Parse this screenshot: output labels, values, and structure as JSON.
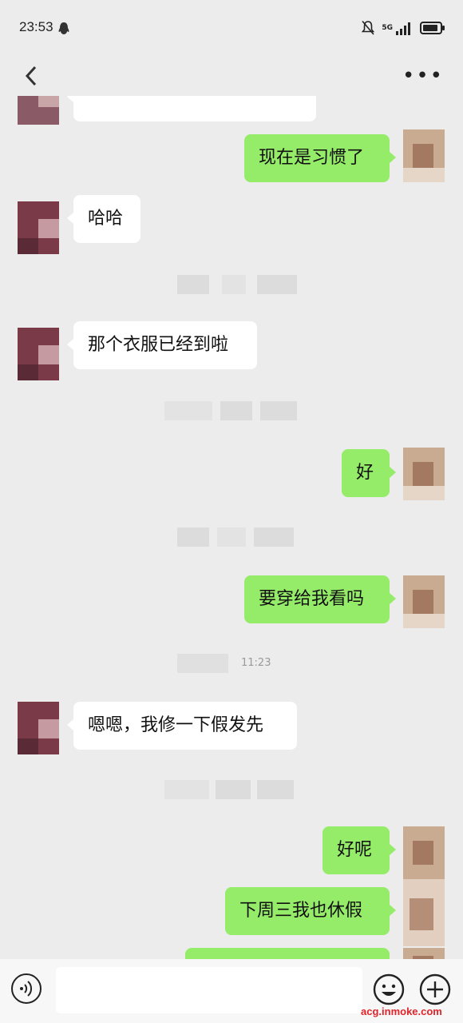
{
  "status": {
    "time": "23:53",
    "network": "5G"
  },
  "header": {
    "title": ""
  },
  "messages": [
    {
      "from": "in",
      "text": ""
    },
    {
      "from": "out",
      "text": "现在是习惯了"
    },
    {
      "from": "in",
      "text": "哈哈"
    },
    {
      "from": "in",
      "text": "那个衣服已经到啦"
    },
    {
      "from": "out",
      "text": "好"
    },
    {
      "from": "out",
      "text": "要穿给我看吗"
    },
    {
      "from": "in",
      "text": "嗯嗯，我修一下假发先"
    },
    {
      "from": "out",
      "text": "好呢"
    },
    {
      "from": "out",
      "text": "下周三我也休假"
    },
    {
      "from": "out",
      "text": ""
    }
  ],
  "timestamps": [
    "",
    "",
    "",
    "",
    "11:23",
    ""
  ],
  "input": {
    "placeholder": ""
  },
  "watermark": "acg.inmoke.com",
  "colors": {
    "outgoing_bubble": "#95ec69",
    "incoming_bubble": "#ffffff",
    "background": "#ececec",
    "watermark": "#e0242a"
  },
  "icons": {
    "voice": "voice-icon",
    "emoji": "emoji-icon",
    "plus": "plus-icon",
    "more": "more-icon",
    "back": "back-arrow-icon"
  }
}
